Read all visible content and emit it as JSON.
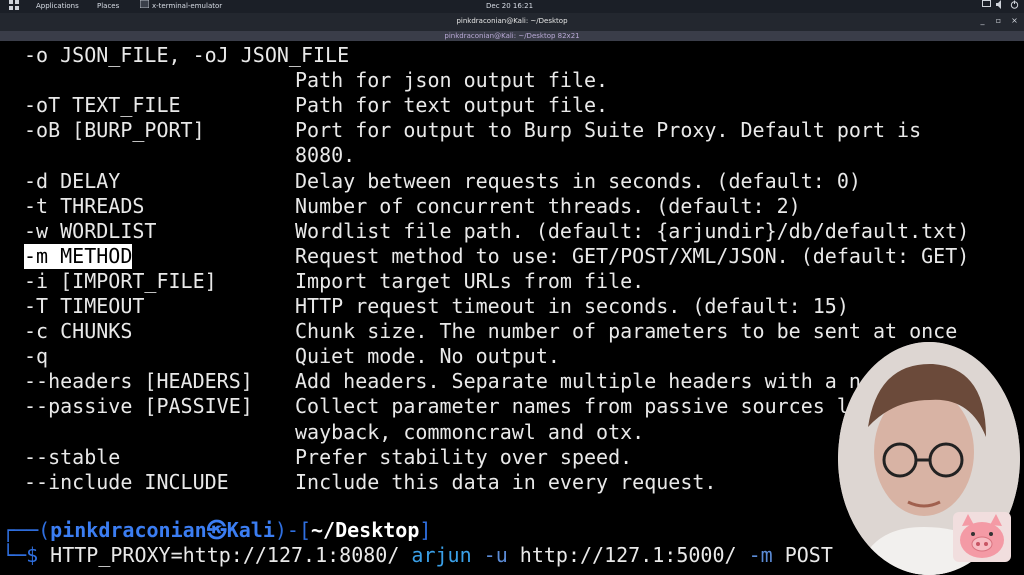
{
  "taskbar": {
    "menu_applications": "Applications",
    "menu_places": "Places",
    "task_terminal": "x-terminal-emulator",
    "clock": "Dec 20  16:21"
  },
  "window": {
    "title": "pinkdraconian@Kali: ~/Desktop",
    "terminal_title": "pinkdraconian@Kali: ~/Desktop 82x21"
  },
  "help_lines": [
    {
      "flag": "-o JSON_FILE, -oJ JSON_FILE",
      "desc": ""
    },
    {
      "flag": "",
      "desc": "Path for json output file."
    },
    {
      "flag": "-oT TEXT_FILE",
      "desc": "Path for text output file."
    },
    {
      "flag": "-oB [BURP_PORT]",
      "desc": "Port for output to Burp Suite Proxy. Default port is"
    },
    {
      "flag": "",
      "desc": "8080."
    },
    {
      "flag": "-d DELAY",
      "desc": "Delay between requests in seconds. (default: 0)"
    },
    {
      "flag": "-t THREADS",
      "desc": "Number of concurrent threads. (default: 2)"
    },
    {
      "flag": "-w WORDLIST",
      "desc": "Wordlist file path. (default: {arjundir}/db/default.txt)"
    },
    {
      "flag": "-m METHOD",
      "desc": "Request method to use: GET/POST/XML/JSON. (default: GET)"
    },
    {
      "flag": "-i [IMPORT_FILE]",
      "desc": "Import target URLs from file."
    },
    {
      "flag": "-T TIMEOUT",
      "desc": "HTTP request timeout in seconds. (default: 15)"
    },
    {
      "flag": "-c CHUNKS",
      "desc": "Chunk size. The number of parameters to be sent at once"
    },
    {
      "flag": "-q",
      "desc": "Quiet mode. No output."
    },
    {
      "flag": "--headers [HEADERS]",
      "desc": "Add headers. Separate multiple headers with a n"
    },
    {
      "flag": "--passive [PASSIVE]",
      "desc": "Collect parameter names from passive sources l"
    },
    {
      "flag": "",
      "desc": "wayback, commoncrawl and otx."
    },
    {
      "flag": "--stable",
      "desc": "Prefer stability over speed."
    },
    {
      "flag": "--include INCLUDE",
      "desc": "Include this data in every request."
    }
  ],
  "highlighted_flag": "-m METHOD",
  "prompt": {
    "open": "┌──(",
    "user": "pinkdraconian",
    "at": "㉿",
    "host": "Kali",
    "mid": ")-[",
    "path": "~/Desktop",
    "close": "]",
    "line2": "└─$ ",
    "cmd_env": "HTTP_PROXY=http://127.1:8080/ ",
    "cmd_name": "arjun",
    "cmd_flag_u": " -u",
    "cmd_url": " http://127.1:5000/ ",
    "cmd_flag_m": "-m",
    "cmd_method": " POST"
  },
  "colors": {
    "terminal_bg": "#000000",
    "terminal_fg": "#e9e9e9",
    "prompt_blue": "#2f6fe0",
    "highlight_bg": "#ffffff"
  },
  "icons": [
    "apps-grid-icon",
    "terminal-icon",
    "webcam-person",
    "pig-sticker-icon"
  ]
}
